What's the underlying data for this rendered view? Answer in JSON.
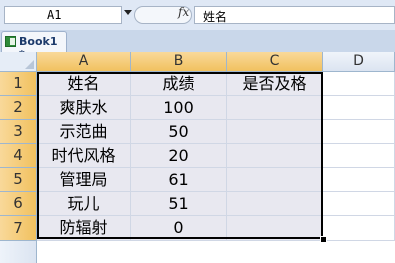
{
  "formula_bar": {
    "name_box": "A1",
    "fx_label": "fx",
    "formula_value": "姓名"
  },
  "workbook_tab": {
    "label": "Book1 *"
  },
  "columns": [
    "A",
    "B",
    "C",
    "D"
  ],
  "rows": [
    "1",
    "2",
    "3",
    "4",
    "5",
    "6",
    "7"
  ],
  "cells": [
    [
      "姓名",
      "成绩",
      "是否及格",
      ""
    ],
    [
      "爽肤水",
      "100",
      "",
      ""
    ],
    [
      "示范曲",
      "50",
      "",
      ""
    ],
    [
      "时代风格",
      "20",
      "",
      ""
    ],
    [
      "管理局",
      "61",
      "",
      ""
    ],
    [
      "玩儿",
      "51",
      "",
      ""
    ],
    [
      "防辐射",
      "0",
      "",
      ""
    ]
  ],
  "icons": {
    "workbook": "excel-workbook-icon",
    "dropdown": "chevron-down-icon",
    "function": "fx-icon"
  }
}
